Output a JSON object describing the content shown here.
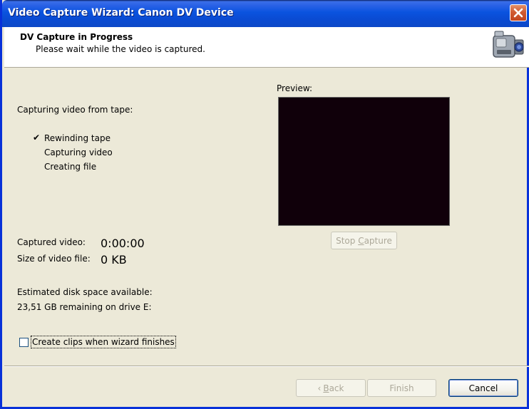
{
  "window": {
    "title": "Video Capture Wizard: Canon DV Device",
    "close_icon": "close-icon"
  },
  "header": {
    "title": "DV Capture in Progress",
    "subtitle": "Please wait while the video is captured.",
    "icon": "camcorder-icon"
  },
  "progress": {
    "heading": "Capturing video from tape:",
    "steps": [
      {
        "label": "Rewinding tape",
        "done": true
      },
      {
        "label": "Capturing video",
        "done": false
      },
      {
        "label": "Creating file",
        "done": false
      }
    ],
    "check_mark": "✔"
  },
  "stats": {
    "captured_label": "Captured video:",
    "captured_value": "0:00:00",
    "size_label": "Size of video file:",
    "size_value": "0 KB",
    "disk_label": "Estimated disk space available:",
    "disk_value": "23,51 GB remaining on drive E:"
  },
  "preview": {
    "label": "Preview:",
    "background": "#10000A"
  },
  "stop_button": {
    "prefix": "Stop ",
    "mnemonic": "C",
    "suffix": "apture"
  },
  "create_clips": {
    "label": "Create clips when wizard finishes",
    "checked": false
  },
  "footer": {
    "back_arrow": "‹",
    "back_mnemonic": "B",
    "back_rest": "ack",
    "finish_label": "Finish",
    "cancel_label": "Cancel"
  },
  "colors": {
    "titlebar": "#0A53DF",
    "dialog_bg": "#ECE9D8",
    "close_button": "#D15B32"
  }
}
